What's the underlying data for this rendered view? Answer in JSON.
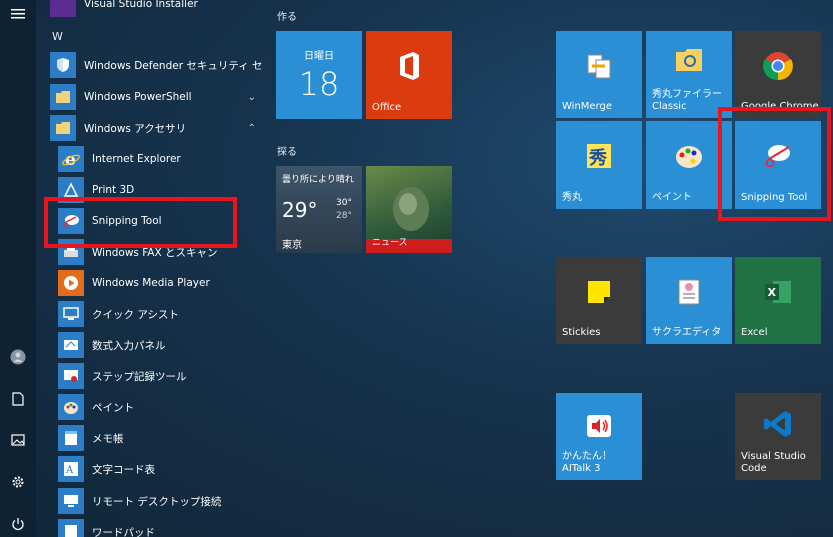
{
  "colors": {
    "accent": "#2b8fd6",
    "highlight": "#e8161c",
    "office": "#dc3b0f"
  },
  "applist": {
    "top_item": "Visual Studio Installer",
    "letter": "W",
    "items": [
      {
        "label": "Windows Defender セキュリティ センター",
        "icon": "shield-icon"
      },
      {
        "label": "Windows PowerShell",
        "icon": "folder-icon",
        "chevron": "⌄"
      },
      {
        "label": "Windows アクセサリ",
        "icon": "folder-icon",
        "chevron": "⌃"
      },
      {
        "label": "Internet Explorer",
        "icon": "internet-explorer-icon"
      },
      {
        "label": "Print 3D",
        "icon": "print3d-icon"
      },
      {
        "label": "Snipping Tool",
        "icon": "snipping-tool-icon"
      },
      {
        "label": "Windows FAX とスキャン",
        "icon": "fax-icon"
      },
      {
        "label": "Windows Media Player",
        "icon": "media-player-icon"
      },
      {
        "label": "クイック アシスト",
        "icon": "quick-assist-icon"
      },
      {
        "label": "数式入力パネル",
        "icon": "math-input-icon"
      },
      {
        "label": "ステップ記録ツール",
        "icon": "steps-recorder-icon"
      },
      {
        "label": "ペイント",
        "icon": "paint-icon"
      },
      {
        "label": "メモ帳",
        "icon": "notepad-icon"
      },
      {
        "label": "文字コード表",
        "icon": "character-map-icon"
      },
      {
        "label": "リモート デスクトップ接続",
        "icon": "remote-desktop-icon"
      },
      {
        "label": "ワードパッド",
        "icon": "wordpad-icon"
      }
    ]
  },
  "groups": {
    "create": "作る",
    "explore": "探る"
  },
  "tiles": {
    "calendar": {
      "day": "日曜日",
      "date": "18"
    },
    "office": {
      "label": "Office"
    },
    "weather": {
      "condition": "曇り所により晴れ",
      "temp": "29°",
      "high": "30°",
      "low": "28°",
      "city": "東京"
    },
    "news": {
      "label": "ニュース"
    },
    "winmerge": {
      "label": "WinMerge"
    },
    "hidemaru_filer": {
      "label": "秀丸ファイラー Classic"
    },
    "chrome": {
      "label": "Google Chrome"
    },
    "hidemaru": {
      "label": "秀丸"
    },
    "paint": {
      "label": "ペイント"
    },
    "snipping": {
      "label": "Snipping Tool"
    },
    "stickies": {
      "label": "Stickies"
    },
    "sakura": {
      "label": "サクラエディタ"
    },
    "excel": {
      "label": "Excel"
    },
    "aitalk": {
      "label": "かんたん！ AITalk 3"
    },
    "vscode": {
      "label": "Visual Studio Code"
    }
  }
}
